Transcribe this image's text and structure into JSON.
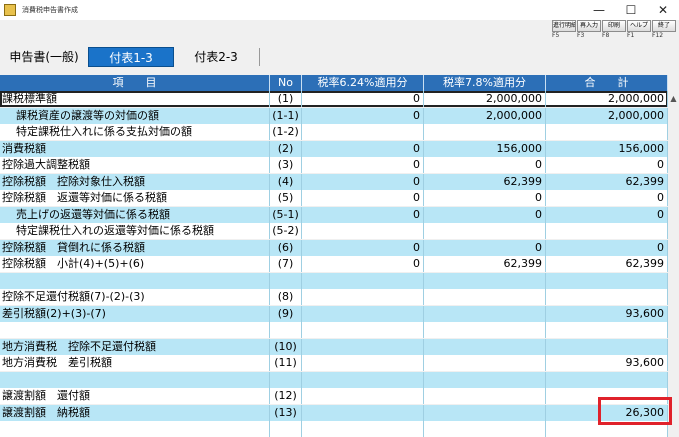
{
  "window": {
    "title": "消費税申告書作成",
    "min_glyph": "—",
    "max_glyph": "☐",
    "close_glyph": "✕"
  },
  "toolbar": {
    "buttons": [
      {
        "label": "進行明細",
        "key": "F5"
      },
      {
        "label": "再入力",
        "key": "F3"
      },
      {
        "label": "印刷",
        "key": "F8"
      },
      {
        "label": "ヘルプ",
        "key": "F1"
      },
      {
        "label": "終了",
        "key": "F12"
      }
    ]
  },
  "tabs": [
    {
      "label": "申告書(一般)"
    },
    {
      "label": "付表1-3"
    },
    {
      "label": "付表2-3"
    }
  ],
  "table": {
    "headers": [
      "項　　目",
      "No",
      "税率6.24%適用分",
      "税率7.8%適用分",
      "合　　計"
    ],
    "rows": [
      {
        "item": "課税標準額",
        "no": "(1)",
        "r1": "0",
        "r2": "2,000,000",
        "total": "2,000,000"
      },
      {
        "item": "課税資産の譲渡等の対価の額",
        "no": "(1-1)",
        "r1": "0",
        "r2": "2,000,000",
        "total": "2,000,000"
      },
      {
        "item": "特定課税仕入れに係る支払対価の額",
        "no": "(1-2)",
        "r1": "",
        "r2": "",
        "total": ""
      },
      {
        "item": "消費税額",
        "no": "(2)",
        "r1": "0",
        "r2": "156,000",
        "total": "156,000"
      },
      {
        "item": "控除過大調整税額",
        "no": "(3)",
        "r1": "0",
        "r2": "0",
        "total": "0"
      },
      {
        "item": "控除税額　控除対象仕入税額",
        "no": "(4)",
        "r1": "0",
        "r2": "62,399",
        "total": "62,399"
      },
      {
        "item": "控除税額　返還等対価に係る税額",
        "no": "(5)",
        "r1": "0",
        "r2": "0",
        "total": "0"
      },
      {
        "item": "売上げの返還等対価に係る税額",
        "no": "(5-1)",
        "r1": "0",
        "r2": "0",
        "total": "0"
      },
      {
        "item": "特定課税仕入れの返還等対価に係る税額",
        "no": "(5-2)",
        "r1": "",
        "r2": "",
        "total": ""
      },
      {
        "item": "控除税額　貸倒れに係る税額",
        "no": "(6)",
        "r1": "0",
        "r2": "0",
        "total": "0"
      },
      {
        "item": "控除税額　小計(4)+(5)+(6)",
        "no": "(7)",
        "r1": "0",
        "r2": "62,399",
        "total": "62,399"
      },
      {
        "item": "",
        "no": "",
        "r1": "",
        "r2": "",
        "total": ""
      },
      {
        "item": "控除不足還付税額(7)-(2)-(3)",
        "no": "(8)",
        "r1": "",
        "r2": "",
        "total": ""
      },
      {
        "item": "差引税額(2)+(3)-(7)",
        "no": "(9)",
        "r1": "",
        "r2": "",
        "total": "93,600"
      },
      {
        "item": "",
        "no": "",
        "r1": "",
        "r2": "",
        "total": ""
      },
      {
        "item": "地方消費税　控除不足還付税額",
        "no": "(10)",
        "r1": "",
        "r2": "",
        "total": ""
      },
      {
        "item": "地方消費税　差引税額",
        "no": "(11)",
        "r1": "",
        "r2": "",
        "total": "93,600"
      },
      {
        "item": "",
        "no": "",
        "r1": "",
        "r2": "",
        "total": ""
      },
      {
        "item": "譲渡割額　還付額",
        "no": "(12)",
        "r1": "",
        "r2": "",
        "total": ""
      },
      {
        "item": "譲渡割額　納税額",
        "no": "(13)",
        "r1": "",
        "r2": "",
        "total": "26,300"
      },
      {
        "item": "",
        "no": "",
        "r1": "",
        "r2": "",
        "total": ""
      }
    ]
  },
  "scrollbar": {
    "up_glyph": "▲"
  }
}
